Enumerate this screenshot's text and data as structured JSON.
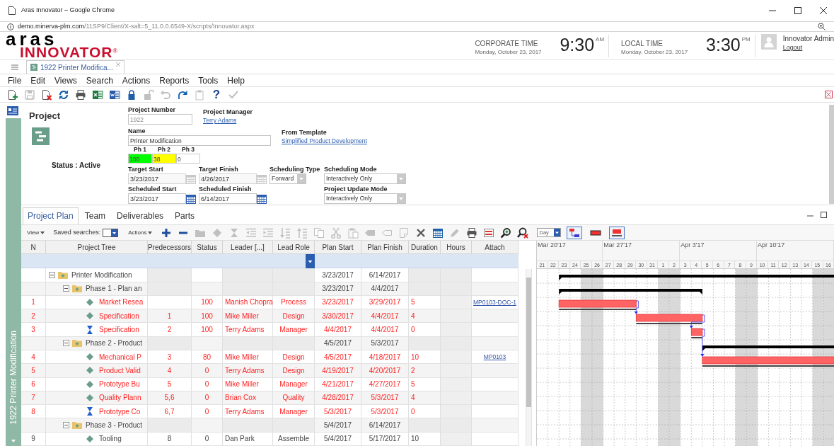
{
  "browser": {
    "title": "Aras Innovator – Google Chrome",
    "url_host": "demo.minerva-plm.com",
    "url_path": "/11SP9/Client/X-salt=5_11.0.0.6549-X/scripts/Innovator.aspx"
  },
  "header": {
    "logo_top": "aras",
    "logo_bottom": "INNOVATOR",
    "logo_mark": "®",
    "clocks": [
      {
        "label": "CORPORATE TIME",
        "date": "Monday, October 23, 2017",
        "time": "9:30",
        "period": "AM"
      },
      {
        "label": "LOCAL TIME",
        "date": "Monday, October 23, 2017",
        "time": "3:30",
        "period": "PM"
      }
    ],
    "user": {
      "name": "Innovator Admin",
      "logout": "Logout"
    }
  },
  "tabs": [
    {
      "label": "1922 Printer Modifica...",
      "selected": true
    }
  ],
  "menu": [
    "File",
    "Edit",
    "Views",
    "Search",
    "Actions",
    "Reports",
    "Tools",
    "Help"
  ],
  "toolbar": [
    {
      "kind": "new",
      "disabled": false
    },
    {
      "kind": "save",
      "disabled": true
    },
    {
      "kind": "delete",
      "disabled": false
    },
    {
      "kind": "refresh",
      "disabled": false
    },
    {
      "kind": "print",
      "disabled": false
    },
    {
      "kind": "excel",
      "disabled": false
    },
    {
      "kind": "word",
      "disabled": false
    },
    {
      "kind": "lock",
      "disabled": false
    },
    {
      "kind": "unlock",
      "disabled": true
    },
    {
      "kind": "undo",
      "disabled": true
    },
    {
      "kind": "redo",
      "disabled": false
    },
    {
      "kind": "clipboard",
      "disabled": true
    },
    {
      "kind": "help",
      "label": "?",
      "disabled": false
    },
    {
      "kind": "check",
      "disabled": true
    }
  ],
  "side_title": "1922 Printer Modification",
  "form": {
    "title": "Project",
    "status": "Status : Active",
    "project_number": {
      "label": "Project Number",
      "value": "1922"
    },
    "project_manager": {
      "label": "Project Manager",
      "link": "Terry Adams"
    },
    "name": {
      "label": "Name",
      "value": "Printer Modification"
    },
    "from_template": {
      "label": "From Template",
      "link": "Simplified Product Development"
    },
    "phases": [
      {
        "label": "Ph 1",
        "value": "100",
        "color": "#00ff00"
      },
      {
        "label": "Ph 2",
        "value": "38",
        "color": "#ffff00"
      },
      {
        "label": "Ph 3",
        "value": "0",
        "color": "#ffffff"
      }
    ],
    "target_start": {
      "label": "Target Start",
      "value": "3/23/2017",
      "disabled": true
    },
    "target_finish": {
      "label": "Target Finish",
      "value": "4/26/2017",
      "disabled": true
    },
    "scheduling_type": {
      "label": "Scheduling Type",
      "value": "Forward"
    },
    "scheduling_mode": {
      "label": "Scheduling Mode",
      "value": "Interactively Only"
    },
    "scheduled_start": {
      "label": "Scheduled Start",
      "value": "3/23/2017",
      "disabled": false
    },
    "scheduled_finish": {
      "label": "Scheduled Finish",
      "value": "6/14/2017",
      "disabled": false
    },
    "project_update_mode": {
      "label": "Project Update Mode",
      "value": "Interactively Only"
    }
  },
  "plan_tabs": [
    {
      "label": "Project Plan",
      "selected": true
    },
    {
      "label": "Team",
      "selected": false
    },
    {
      "label": "Deliverables",
      "selected": false
    },
    {
      "label": "Parts",
      "selected": false
    }
  ],
  "grid_toolbar": {
    "view": "View",
    "saved_searches": "Saved searches:",
    "actions": "Actions",
    "tools": [
      {
        "kind": "add",
        "disabled": false
      },
      {
        "kind": "remove",
        "disabled": false
      },
      {
        "kind": "folder",
        "disabled": true
      },
      {
        "kind": "diamond",
        "disabled": true
      },
      {
        "kind": "hourglass",
        "disabled": true
      },
      {
        "kind": "outdent",
        "disabled": true
      },
      {
        "kind": "indent",
        "disabled": true
      },
      {
        "kind": "movedown",
        "disabled": true
      },
      {
        "kind": "moveup",
        "disabled": true
      },
      {
        "kind": "copy",
        "disabled": true
      },
      {
        "kind": "cut",
        "disabled": true
      },
      {
        "kind": "paste",
        "disabled": true
      },
      {
        "kind": "tag",
        "disabled": true
      },
      {
        "kind": "tagoutline",
        "disabled": true
      },
      {
        "kind": "note",
        "disabled": true
      },
      {
        "kind": "x",
        "disabled": false
      },
      {
        "kind": "calendar",
        "disabled": false
      },
      {
        "kind": "pencil",
        "disabled": true
      },
      {
        "kind": "print",
        "disabled": false
      },
      {
        "kind": "baseline",
        "disabled": false
      },
      {
        "kind": "zoomin",
        "disabled": false
      },
      {
        "kind": "zoomclear",
        "disabled": false
      }
    ],
    "scale": "Day",
    "toggles": [
      {
        "kind": "links",
        "selected": true
      },
      {
        "kind": "bars",
        "selected": false
      },
      {
        "kind": "baseline",
        "selected": true
      }
    ]
  },
  "table": {
    "columns": [
      "N",
      "Project Tree",
      "Predecessors",
      "Status",
      "Leader [...]",
      "Lead Role",
      "Plan Start",
      "Plan Finish",
      "Duration",
      "Hours",
      "Attach"
    ],
    "rows": [
      {
        "name": "Printer Modification",
        "kind": "project",
        "expanded": true,
        "late": false,
        "plan_start": "3/23/2017",
        "plan_finish": "6/14/2017",
        "children": [
          {
            "name": "Phase 1 - Plan an",
            "kind": "phase",
            "expanded": true,
            "late": false,
            "plan_start": "3/23/2017",
            "plan_finish": "4/4/2017",
            "children": [
              {
                "n": "1",
                "name": "Market Resea",
                "kind": "task",
                "late": true,
                "status": "100",
                "leader": "Manish Chopra",
                "lead_role": "Process",
                "plan_start": "3/23/2017",
                "plan_finish": "3/29/2017",
                "duration": "5",
                "attach": "MP0103-DOC-1"
              },
              {
                "n": "2",
                "name": "Specification",
                "kind": "task",
                "late": true,
                "predecessors": "1",
                "status": "100",
                "leader": "Mike Miller",
                "lead_role": "Design",
                "plan_start": "3/30/2017",
                "plan_finish": "4/4/2017",
                "duration": "4"
              },
              {
                "n": "3",
                "name": "Specification",
                "kind": "milestone",
                "late": true,
                "predecessors": "2",
                "status": "100",
                "leader": "Terry Adams",
                "lead_role": "Manager",
                "plan_start": "4/4/2017",
                "plan_finish": "4/4/2017",
                "duration": "0"
              }
            ]
          },
          {
            "name": "Phase 2 - Product",
            "kind": "phase",
            "expanded": true,
            "late": false,
            "plan_start": "4/5/2017",
            "plan_finish": "5/3/2017",
            "children": [
              {
                "n": "4",
                "name": "Mechanical P",
                "kind": "task",
                "late": true,
                "predecessors": "3",
                "status": "80",
                "leader": "Mike Miller",
                "lead_role": "Design",
                "plan_start": "4/5/2017",
                "plan_finish": "4/18/2017",
                "duration": "10",
                "attach": "MP0103"
              },
              {
                "n": "5",
                "name": "Product Valid",
                "kind": "task",
                "late": true,
                "predecessors": "4",
                "status": "0",
                "leader": "Terry Adams",
                "lead_role": "Design",
                "plan_start": "4/19/2017",
                "plan_finish": "4/20/2017",
                "duration": "2"
              },
              {
                "n": "6",
                "name": "Prototype Bu",
                "kind": "task",
                "late": true,
                "predecessors": "5",
                "status": "0",
                "leader": "Mike Miller",
                "lead_role": "Manager",
                "plan_start": "4/21/2017",
                "plan_finish": "4/27/2017",
                "duration": "5"
              },
              {
                "n": "7",
                "name": "Quality Plann",
                "kind": "task",
                "late": true,
                "predecessors": "5,6",
                "status": "0",
                "leader": "Brian Cox",
                "lead_role": "Quality",
                "plan_start": "4/28/2017",
                "plan_finish": "5/3/2017",
                "duration": "4"
              },
              {
                "n": "8",
                "name": "Prototype Co",
                "kind": "milestone",
                "late": true,
                "predecessors": "6,7",
                "status": "0",
                "leader": "Terry Adams",
                "lead_role": "Manager",
                "plan_start": "5/3/2017",
                "plan_finish": "5/3/2017",
                "duration": "0"
              }
            ]
          },
          {
            "name": "Phase 3 - Product",
            "kind": "phase",
            "expanded": true,
            "late": false,
            "plan_start": "5/4/2017",
            "plan_finish": "6/14/2017",
            "children": [
              {
                "n": "9",
                "name": "Tooling",
                "kind": "task",
                "late": false,
                "predecessors": "8",
                "status": "0",
                "leader": "Dan Park",
                "lead_role": "Assemble",
                "plan_start": "5/4/2017",
                "plan_finish": "5/17/2017",
                "duration": "10"
              }
            ]
          }
        ]
      }
    ]
  },
  "gantt": {
    "weeks": [
      "Mar 20'17",
      "Mar 27'17",
      "Apr 3'17",
      "Apr 10'17"
    ],
    "days": [
      "21",
      "22",
      "23",
      "24",
      "25",
      "26",
      "27",
      "28",
      "29",
      "30",
      "31",
      "1",
      "2",
      "3",
      "4",
      "5",
      "6",
      "7",
      "8",
      "9",
      "10",
      "11",
      "12",
      "13",
      "14",
      "15",
      "16"
    ]
  }
}
